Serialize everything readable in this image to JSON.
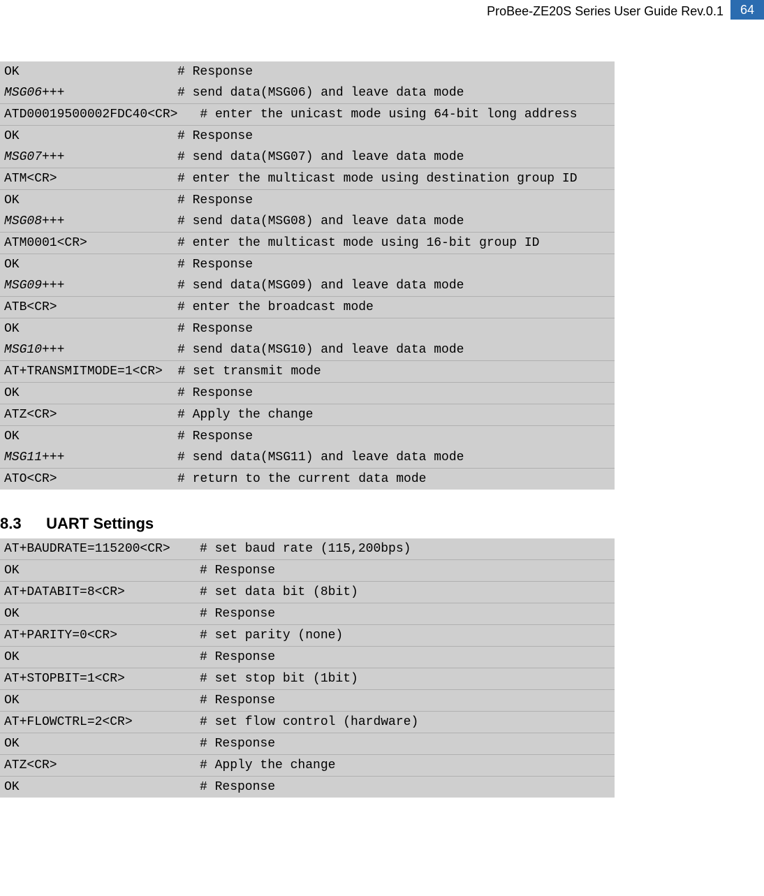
{
  "header": {
    "title": "ProBee-ZE20S Series User Guide Rev.0.1",
    "page": "64"
  },
  "block1": {
    "lines": [
      {
        "cmd": "OK",
        "comment": "# Response",
        "italic": false,
        "sep": false
      },
      {
        "cmd": "MSG06+++",
        "comment": "# send data(MSG06) and leave data mode",
        "italic": true,
        "sep": false
      },
      {
        "cmd": "ATD00019500002FDC40<CR>",
        "comment": "   # enter the unicast mode using 64-bit long address",
        "italic": false,
        "sep": true
      },
      {
        "cmd": "OK",
        "comment": "# Response",
        "italic": false,
        "sep": true
      },
      {
        "cmd": "MSG07+++",
        "comment": "# send data(MSG07) and leave data mode",
        "italic": true,
        "sep": false
      },
      {
        "cmd": "ATM<CR>",
        "comment": "# enter the multicast mode using destination group ID",
        "italic": false,
        "sep": true
      },
      {
        "cmd": "OK",
        "comment": "# Response",
        "italic": false,
        "sep": true
      },
      {
        "cmd": "MSG08+++",
        "comment": "# send data(MSG08) and leave data mode",
        "italic": true,
        "sep": false
      },
      {
        "cmd": "ATM0001<CR>",
        "comment": "# enter the multicast mode using 16-bit group ID",
        "italic": false,
        "sep": true
      },
      {
        "cmd": "OK",
        "comment": "# Response",
        "italic": false,
        "sep": true
      },
      {
        "cmd": "MSG09+++",
        "comment": "# send data(MSG09) and leave data mode",
        "italic": true,
        "sep": false
      },
      {
        "cmd": "ATB<CR>",
        "comment": "# enter the broadcast mode",
        "italic": false,
        "sep": true
      },
      {
        "cmd": "OK",
        "comment": "# Response",
        "italic": false,
        "sep": true
      },
      {
        "cmd": "MSG10+++",
        "comment": "# send data(MSG10) and leave data mode",
        "italic": true,
        "sep": false
      },
      {
        "cmd": "AT+TRANSMITMODE=1<CR>",
        "comment": "  # set transmit mode",
        "italic": false,
        "sep": true,
        "nogap": true
      },
      {
        "cmd": "OK",
        "comment": "# Response",
        "italic": false,
        "sep": true
      },
      {
        "cmd": "ATZ<CR>",
        "comment": "# Apply the change",
        "italic": false,
        "sep": true
      },
      {
        "cmd": "OK",
        "comment": "# Response",
        "italic": false,
        "sep": true
      },
      {
        "cmd": "MSG11+++",
        "comment": "# send data(MSG11) and leave data mode",
        "italic": true,
        "sep": false
      },
      {
        "cmd": "ATO<CR>",
        "comment": "# return to the current data mode",
        "italic": false,
        "sep": true
      }
    ]
  },
  "section": {
    "num": "8.3",
    "title": "UART Settings"
  },
  "block2": {
    "lines": [
      {
        "cmd": "AT+BAUDRATE=115200<CR>",
        "comment": "# set baud rate (115,200bps)",
        "italic": false,
        "sep": false
      },
      {
        "cmd": "OK",
        "comment": "# Response",
        "italic": false,
        "sep": true
      },
      {
        "cmd": "AT+DATABIT=8<CR>",
        "comment": "# set data bit (8bit)",
        "italic": false,
        "sep": true
      },
      {
        "cmd": "OK",
        "comment": "# Response",
        "italic": false,
        "sep": true
      },
      {
        "cmd": "AT+PARITY=0<CR>",
        "comment": "# set parity (none)",
        "italic": false,
        "sep": true
      },
      {
        "cmd": "OK",
        "comment": "# Response",
        "italic": false,
        "sep": true
      },
      {
        "cmd": "AT+STOPBIT=1<CR>",
        "comment": "# set stop bit (1bit)",
        "italic": false,
        "sep": true
      },
      {
        "cmd": "OK",
        "comment": "# Response",
        "italic": false,
        "sep": true
      },
      {
        "cmd": "AT+FLOWCTRL=2<CR>",
        "comment": "# set flow control (hardware)",
        "italic": false,
        "sep": true
      },
      {
        "cmd": "OK",
        "comment": "# Response",
        "italic": false,
        "sep": true
      },
      {
        "cmd": "ATZ<CR>",
        "comment": "# Apply the change",
        "italic": false,
        "sep": true
      },
      {
        "cmd": "OK",
        "comment": "# Response",
        "italic": false,
        "sep": true
      }
    ]
  }
}
